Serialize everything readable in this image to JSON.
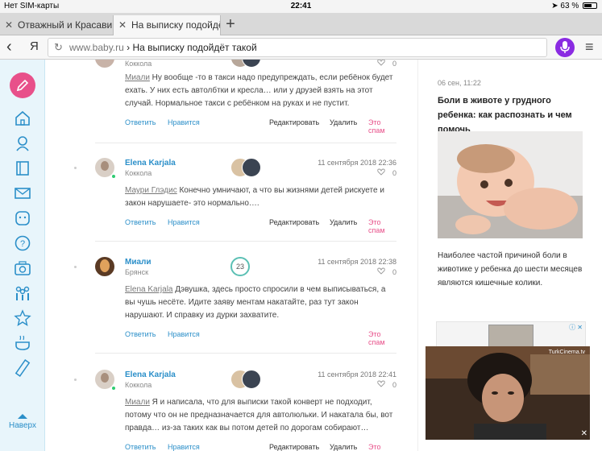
{
  "statusbar": {
    "carrier": "Нет SIM-карты",
    "time": "22:41",
    "battery_percent": "63 %",
    "battery_level": 0.63
  },
  "tabs": [
    {
      "label": "Отважный и Красавиц",
      "active": false
    },
    {
      "label": "На выписку подойдёт",
      "active": true
    }
  ],
  "newtab_label": "+",
  "address": {
    "back_label": "‹",
    "brand": "Я",
    "domain": "www.baby.ru",
    "separator": " › ",
    "page": "На выписку подойдёт такой"
  },
  "sidebar": {
    "icons": [
      "home-icon",
      "baby-icon",
      "book-icon",
      "mail-icon",
      "face-icon",
      "help-icon",
      "camera-icon",
      "people-icon",
      "star-icon",
      "pot-icon",
      "ruler-icon"
    ],
    "up_label": "Наверх"
  },
  "comments": [
    {
      "partial": true,
      "city": "Коккола",
      "likes": "0",
      "mention": "Миали",
      "text": " Ну вообще -то в такси надо предупреждать, если ребёнок будет ехать. У них есть автолбтки и кресла… или у друзей взять на этот случай. Нормальное такси с ребёнком на руках и не пустит.",
      "actions": {
        "reply": "Ответить",
        "like": "Нравится",
        "edit": "Редактировать",
        "delete": "Удалить",
        "spam": "Это спам"
      }
    },
    {
      "author": "Elena Karjala",
      "city": "Коккола",
      "date": "11 сентября 2018 22:36",
      "likes": "0",
      "mention": "Маури Глэдис",
      "text": " Конечно умничают, а что вы жизнями детей рискуете и закон нарушаете- это нормально….",
      "actions": {
        "reply": "Ответить",
        "like": "Нравится",
        "edit": "Редактировать",
        "delete": "Удалить",
        "spam": "Это спам"
      }
    },
    {
      "author": "Миали",
      "city": "Брянск",
      "ring": "23",
      "date": "11 сентября 2018 22:38",
      "likes": "0",
      "mention": "Elena Karjala",
      "text": " Дэвушка, здесь просто спросили в чем выписываться, а вы чушь несёте. Идите заяву ментам накатайте, раз тут закон нарушают. И справку из дурки захватите.",
      "actions": {
        "reply": "Ответить",
        "like": "Нравится",
        "spam": "Это спам"
      }
    },
    {
      "author": "Elena Karjala",
      "city": "Коккола",
      "date": "11 сентября 2018 22:41",
      "likes": "0",
      "mention": "Миали",
      "text": " Я и написала, что для выписки такой конверт не подходит, потому что он не предназначается для автолюльки. И накатала бы, вот правда… из-за таких как вы потом детей по дорогам собирают…",
      "actions": {
        "reply": "Ответить",
        "like": "Нравится",
        "edit": "Редактировать",
        "delete": "Удалить",
        "spam": "Это спам"
      }
    }
  ],
  "article": {
    "date": "06 сен, 11:22",
    "title": "Боли в животе у грудного ребенка: как распознать и чем помочь",
    "description": "Наиболее частой причиной боли в животике у ребенка до шести месяцев являются кишечные колики."
  },
  "ad": {
    "label": "ⓘ ✕"
  },
  "video": {
    "brand": "TurkCinema.tv",
    "close": "✕"
  },
  "colors": {
    "accent": "#2b8fc9",
    "pink": "#e8508a",
    "mic": "#8a2be2"
  }
}
